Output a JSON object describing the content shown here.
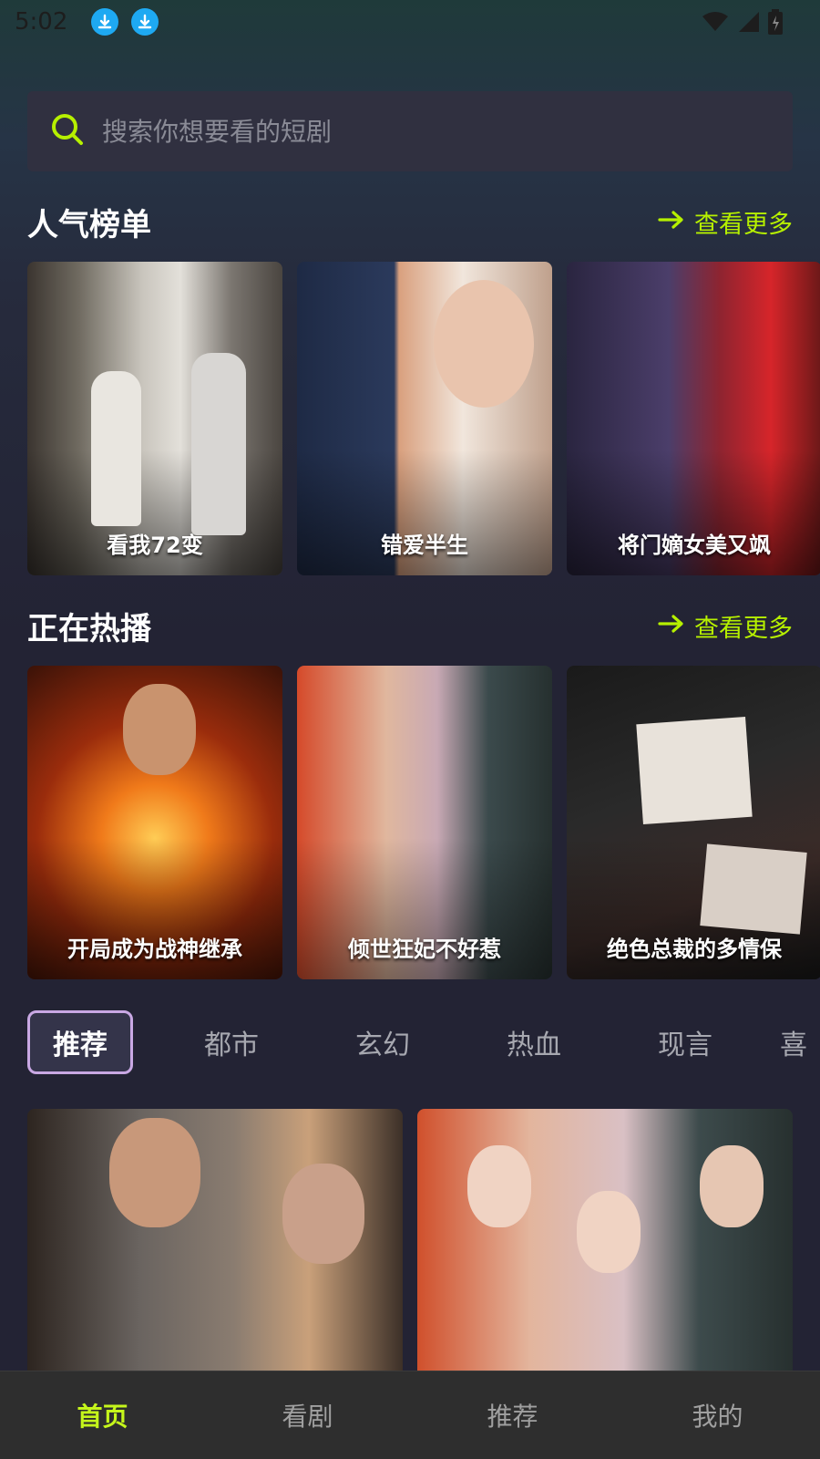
{
  "status": {
    "time": "5:02"
  },
  "search": {
    "placeholder": "搜索你想要看的短剧"
  },
  "popular": {
    "title": "人气榜单",
    "more": "查看更多",
    "items": [
      {
        "title": "看我72变"
      },
      {
        "title": "错爱半生"
      },
      {
        "title": "将门嫡女美又飒"
      }
    ]
  },
  "hot": {
    "title": "正在热播",
    "more": "查看更多",
    "items": [
      {
        "title": "开局成为战神继承"
      },
      {
        "title": "倾世狂妃不好惹"
      },
      {
        "title": "绝色总裁的多情保"
      }
    ]
  },
  "tabs": [
    "推荐",
    "都市",
    "玄幻",
    "热血",
    "现言",
    "喜"
  ],
  "bottom_nav": [
    "首页",
    "看剧",
    "推荐",
    "我的"
  ],
  "colors": {
    "accent": "#c5f51b",
    "more_link": "#b6f000",
    "tab_border": "#c9a8e4"
  }
}
